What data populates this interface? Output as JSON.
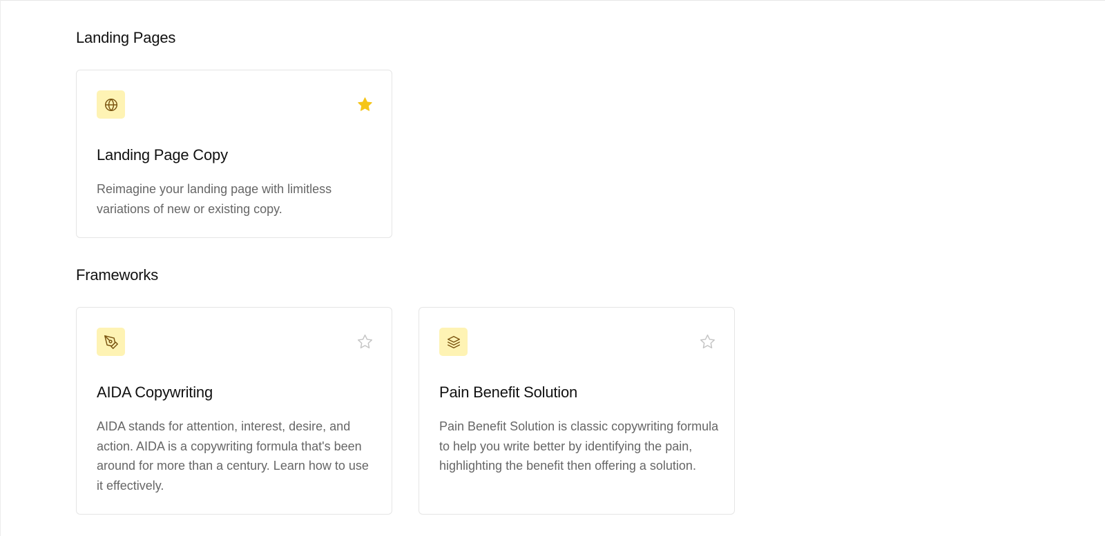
{
  "colors": {
    "icon_background": "#fef3b4",
    "icon_stroke": "#7a5410",
    "star_active": "#f5c518",
    "star_inactive": "#c4c4c4",
    "card_border": "#e5e5e5",
    "description_text": "#666666"
  },
  "sections": [
    {
      "title": "Landing Pages",
      "cards": [
        {
          "icon": "globe-icon",
          "title": "Landing Page Copy",
          "description": "Reimagine your landing page with limitless variations of new or existing copy.",
          "favorited": true
        }
      ]
    },
    {
      "title": "Frameworks",
      "cards": [
        {
          "icon": "pen-tool-icon",
          "title": "AIDA Copywriting",
          "description": "AIDA stands for attention, interest, desire, and action. AIDA is a copywriting formula that's been around for more than a century. Learn how to use it effectively.",
          "favorited": false
        },
        {
          "icon": "layers-icon",
          "title": "Pain Benefit Solution",
          "description": "Pain Benefit Solution is classic copywriting formula to help you write better by identifying the pain, highlighting the benefit then offering a solution.",
          "favorited": false
        }
      ]
    }
  ]
}
